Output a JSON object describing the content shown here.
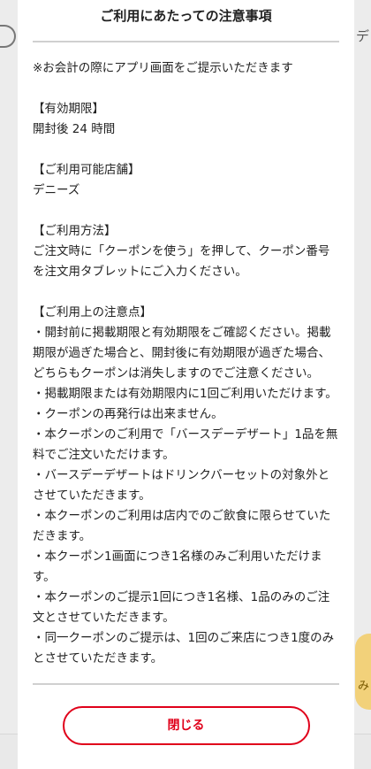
{
  "background": {
    "right_edge_text": "デ",
    "mascot_text": "み",
    "accent": "#f2d17a"
  },
  "modal": {
    "title": "ご利用にあたっての注意事項",
    "intro": "※お会計の際にアプリ画面をご提示いただきます",
    "sections": [
      {
        "heading": "【有効期限】",
        "lines": [
          "開封後 24 時間"
        ]
      },
      {
        "heading": "【ご利用可能店舗】",
        "lines": [
          "デニーズ"
        ]
      },
      {
        "heading": "【ご利用方法】",
        "lines": [
          "ご注文時に「クーポンを使う」を押して、クーポン番号を注文用タブレットにご入力ください。"
        ]
      },
      {
        "heading": "【ご利用上の注意点】",
        "lines": [
          "・開封前に掲載期限と有効期限をご確認ください。掲載期限が過ぎた場合と、開封後に有効期限が過ぎた場合、どちらもクーポンは消失しますのでご注意ください。",
          "・掲載期限または有効期限内に1回ご利用いただけます。",
          "・クーポンの再発行は出来ません。",
          "・本クーポンのご利用で「バースデーデザート」1品を無料でご注文いただけます。",
          "・バースデーデザートはドリンクバーセットの対象外とさせていただきます。",
          "・本クーポンのご利用は店内でのご飲食に限らせていただきます。",
          "・本クーポン1画面につき1名様のみご利用いただけます。",
          "・本クーポンのご提示1回につき1名様、1品のみのご注文とさせていただきます。",
          "・同一クーポンのご提示は、1回のご来店につき1度のみとさせていただきます。"
        ]
      }
    ],
    "close_label": "閉じる",
    "close_color": "#e0001a"
  }
}
